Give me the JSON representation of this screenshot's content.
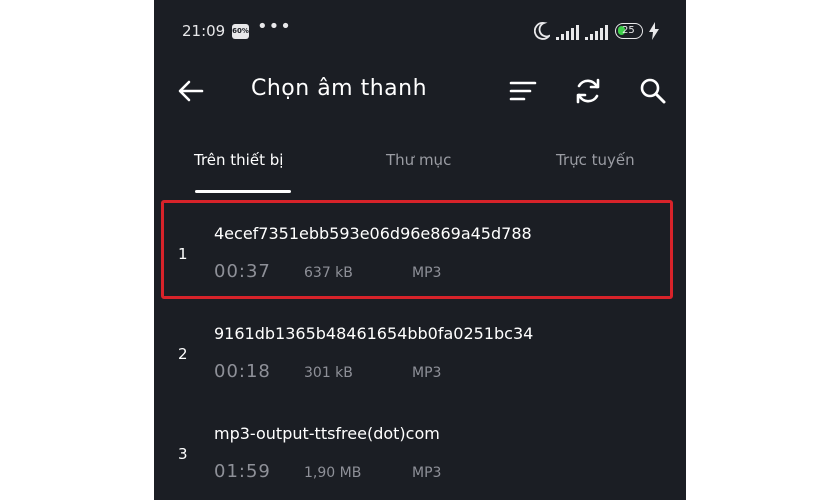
{
  "status_bar": {
    "time": "21:09",
    "app_icon_text": "60%",
    "more": "•••",
    "battery": "25"
  },
  "app_bar": {
    "title": "Chọn âm thanh"
  },
  "tabs": [
    {
      "label": "Trên thiết bị",
      "active": true
    },
    {
      "label": "Thư mục",
      "active": false
    },
    {
      "label": "Trực tuyến",
      "active": false
    }
  ],
  "items": [
    {
      "index": "1",
      "name": "4ecef7351ebb593e06d96e869a45d788",
      "duration": "00:37",
      "size": "637 kB",
      "format": "MP3",
      "highlighted": true
    },
    {
      "index": "2",
      "name": "9161db1365b48461654bb0fa0251bc34",
      "duration": "00:18",
      "size": "301 kB",
      "format": "MP3",
      "highlighted": false
    },
    {
      "index": "3",
      "name": "mp3-output-ttsfree(dot)com",
      "duration": "01:59",
      "size": "1,90 MB",
      "format": "MP3",
      "highlighted": false
    }
  ],
  "colors": {
    "background": "#1b1e24",
    "highlight_border": "#d8232a",
    "battery_green": "#3ecf4a"
  },
  "icons": [
    "moon-icon",
    "signal-icon",
    "battery-icon",
    "charging-icon",
    "back-arrow-icon",
    "sort-icon",
    "refresh-icon",
    "search-icon"
  ]
}
